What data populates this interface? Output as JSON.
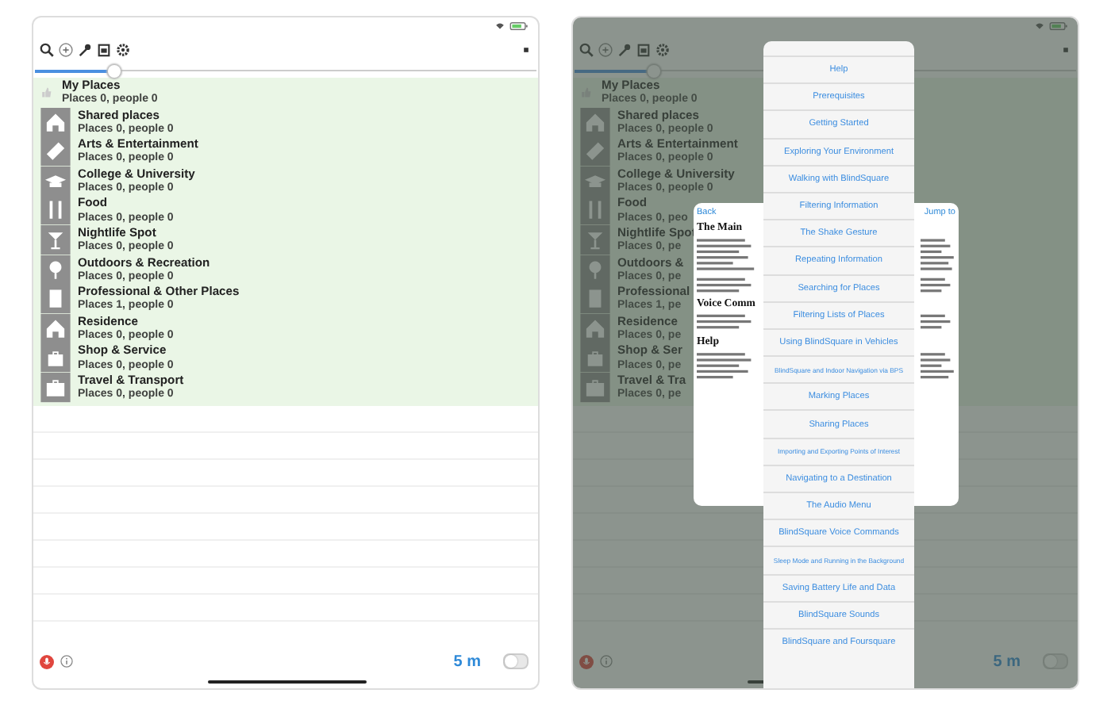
{
  "screens": [
    {
      "dimmed": false,
      "slider": {
        "level": 0.15
      },
      "places": {
        "title": "My Places",
        "summary": "Places 0, people 0",
        "categories": [
          {
            "name": "Shared places",
            "summary": "Places 0, people 0"
          },
          {
            "name": "Arts & Entertainment",
            "summary": "Places 0, people 0"
          },
          {
            "name": "College & University",
            "summary": "Places 0, people 0"
          },
          {
            "name": "Food",
            "summary": "Places 0, people 0"
          },
          {
            "name": "Nightlife Spot",
            "summary": "Places 0, people 0"
          },
          {
            "name": "Outdoors & Recreation",
            "summary": "Places 0, people 0"
          },
          {
            "name": "Professional & Other Places",
            "summary": "Places 1, people 0"
          },
          {
            "name": "Residence",
            "summary": "Places 0, people 0"
          },
          {
            "name": "Shop & Service",
            "summary": "Places 0, people 0"
          },
          {
            "name": "Travel & Transport",
            "summary": "Places 0, people 0"
          }
        ]
      },
      "accuracy": "5 m",
      "sleep_mode": {
        "on": false
      }
    },
    {
      "dimmed": true,
      "slider": {
        "level": 0.15
      },
      "places": {
        "title": "My Places",
        "summary": "Places 0, people 0",
        "categories": [
          {
            "name": "Shared places",
            "summary": "Places 0, people 0"
          },
          {
            "name": "Arts & Entertainment",
            "summary": "Places 0, people 0"
          },
          {
            "name": "College & University",
            "summary": "Places 0, people 0"
          },
          {
            "name": "Food",
            "summary": "Places 0, peo"
          },
          {
            "name": "Nightlife Spot",
            "summary": "Places 0, pe"
          },
          {
            "name": "Outdoors &",
            "summary": "Places 0, pe"
          },
          {
            "name": "Professional",
            "summary": "Places 1, pe"
          },
          {
            "name": "Residence",
            "summary": "Places 0, pe"
          },
          {
            "name": "Shop & Ser",
            "summary": "Places 0, pe"
          },
          {
            "name": "Travel & Tra",
            "summary": "Places 0, pe"
          }
        ]
      },
      "accuracy": "5 m",
      "sleep_mode": {
        "on": false
      },
      "help_document": {
        "back": "Back",
        "jump_to": "Jump to",
        "headings": [
          "The Main",
          "Voice Comm",
          "Help"
        ]
      },
      "topics_menu": [
        "Help",
        "Prerequisites",
        "Getting Started",
        "Exploring Your Environment",
        "Walking with BlindSquare",
        "Filtering Information",
        "The Shake Gesture",
        "Repeating Information",
        "Searching for Places",
        "Filtering Lists of Places",
        "Using BlindSquare in Vehicles",
        "BlindSquare and Indoor Navigation via BPS",
        "Marking Places",
        "Sharing Places",
        "Importing and Exporting Points of Interest",
        "Navigating to a Destination",
        "The Audio Menu",
        "BlindSquare Voice Commands",
        "Sleep Mode and Running in the Background",
        "Saving Battery Life and Data",
        "BlindSquare Sounds",
        "BlindSquare and Foursquare"
      ]
    }
  ]
}
